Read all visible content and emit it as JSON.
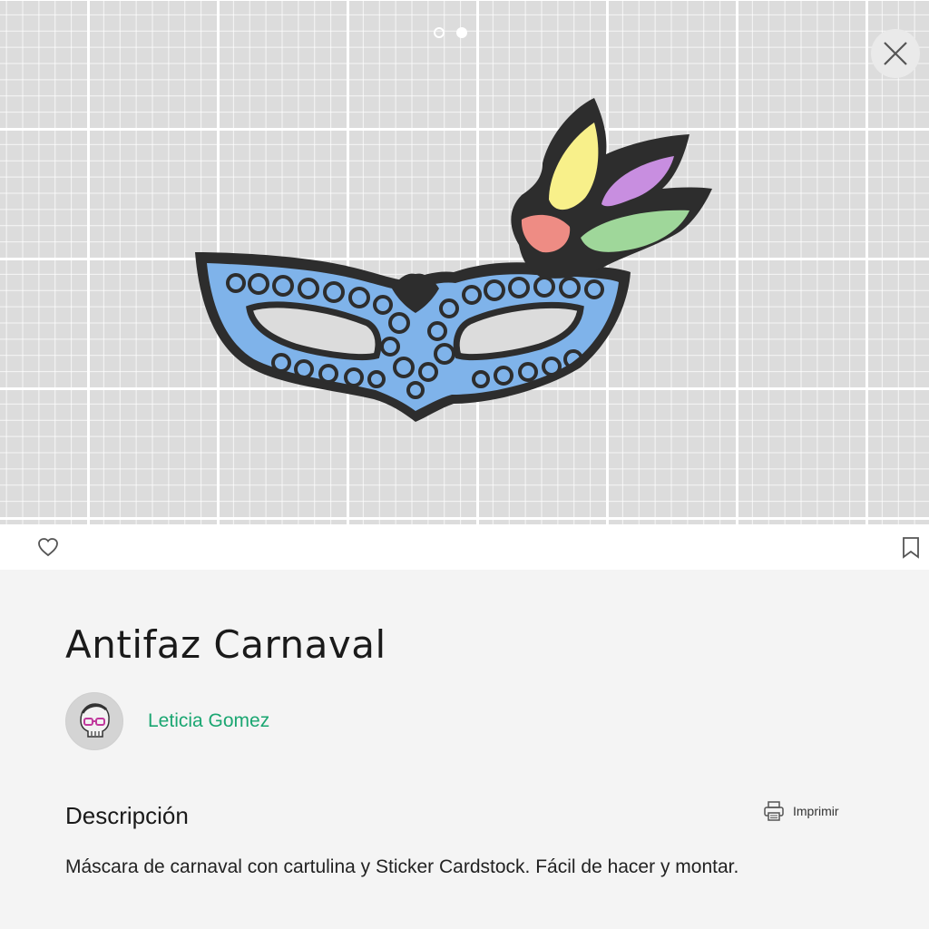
{
  "project": {
    "title": "Antifaz Carnaval",
    "author": "Leticia Gomez"
  },
  "description": {
    "heading": "Descripción",
    "text": "Máscara de carnaval con cartulina y Sticker Cardstock. Fácil de hacer y montar.",
    "print_label": "Imprimir"
  },
  "carousel": {
    "total_slides": 2,
    "active_slide": 2
  },
  "icons": {
    "close": "close-icon",
    "like": "heart-icon",
    "save": "bookmark-icon",
    "print": "printer-icon"
  },
  "colors": {
    "author_link": "#1aa671",
    "mat_background": "#dcdcdc",
    "mask_fill": "#7fb3ea",
    "mask_outline": "#2d2d2d",
    "feather_yellow": "#f8f08a",
    "feather_purple": "#c88ee0",
    "feather_red": "#ee8c84",
    "feather_green": "#9fd79a"
  }
}
